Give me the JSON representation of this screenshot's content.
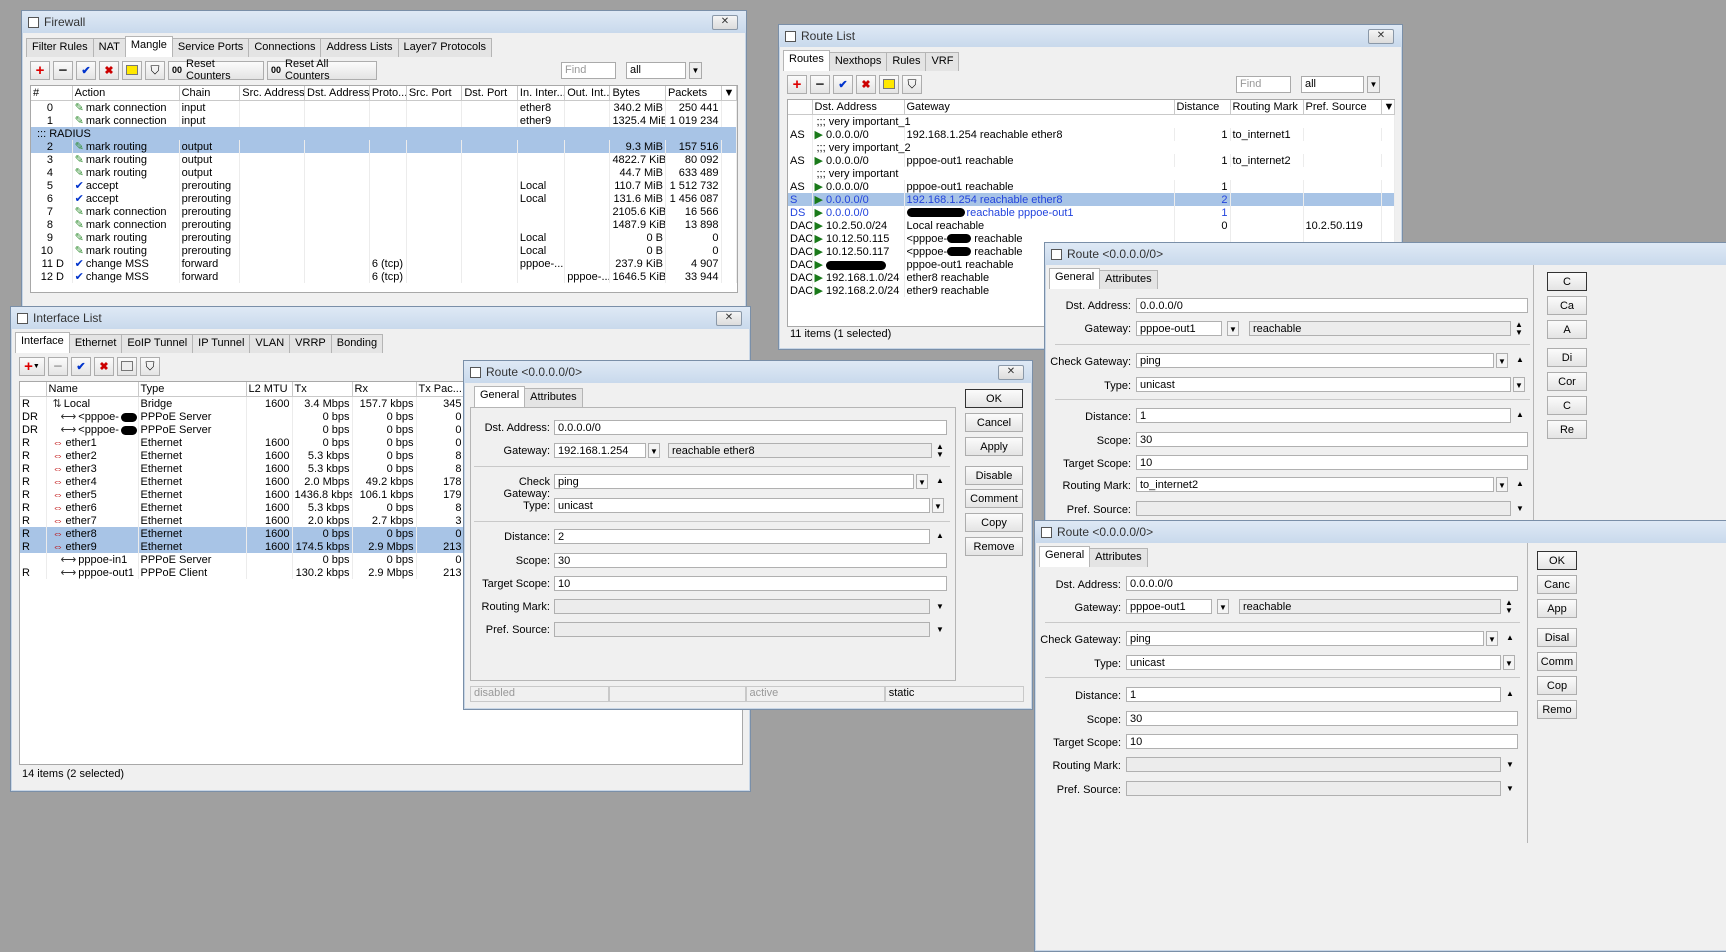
{
  "firewall": {
    "title": "Firewall",
    "tabs": [
      "Filter Rules",
      "NAT",
      "Mangle",
      "Service Ports",
      "Connections",
      "Address Lists",
      "Layer7 Protocols"
    ],
    "active_tab": "Mangle",
    "reset_counters": "Reset Counters",
    "reset_all_counters": "Reset All Counters",
    "find_placeholder": "Find",
    "filter_value": "all",
    "columns": [
      "#",
      "Action",
      "Chain",
      "Src. Address",
      "Dst. Address",
      "Proto...",
      "Src. Port",
      "Dst. Port",
      "In. Inter...",
      "Out. Int...",
      "Bytes",
      "Packets"
    ],
    "group_label": "::: RADIUS",
    "rows": [
      {
        "n": "0",
        "flag": "",
        "icon": "pen",
        "action": "mark connection",
        "chain": "input",
        "proto": "",
        "in": "ether8",
        "out": "",
        "bytes": "340.2 MiB",
        "packets": "250 441"
      },
      {
        "n": "1",
        "flag": "",
        "icon": "pen",
        "action": "mark connection",
        "chain": "input",
        "proto": "",
        "in": "ether9",
        "out": "",
        "bytes": "1325.4 MiB",
        "packets": "1 019 234"
      },
      {
        "n": "2",
        "flag": "",
        "icon": "pen",
        "action": "mark routing",
        "chain": "output",
        "proto": "",
        "in": "",
        "out": "",
        "bytes": "9.3 MiB",
        "packets": "157 516"
      },
      {
        "n": "3",
        "flag": "",
        "icon": "pen",
        "action": "mark routing",
        "chain": "output",
        "proto": "",
        "in": "",
        "out": "",
        "bytes": "4822.7 KiB",
        "packets": "80 092"
      },
      {
        "n": "4",
        "flag": "",
        "icon": "pen",
        "action": "mark routing",
        "chain": "output",
        "proto": "",
        "in": "",
        "out": "",
        "bytes": "44.7 MiB",
        "packets": "633 489"
      },
      {
        "n": "5",
        "flag": "",
        "icon": "check",
        "action": "accept",
        "chain": "prerouting",
        "proto": "",
        "in": "Local",
        "out": "",
        "bytes": "110.7 MiB",
        "packets": "1 512 732"
      },
      {
        "n": "6",
        "flag": "",
        "icon": "check",
        "action": "accept",
        "chain": "prerouting",
        "proto": "",
        "in": "Local",
        "out": "",
        "bytes": "131.6 MiB",
        "packets": "1 456 087"
      },
      {
        "n": "7",
        "flag": "",
        "icon": "pen",
        "action": "mark connection",
        "chain": "prerouting",
        "proto": "",
        "in": "",
        "out": "",
        "bytes": "2105.6 KiB",
        "packets": "16 566"
      },
      {
        "n": "8",
        "flag": "",
        "icon": "pen",
        "action": "mark connection",
        "chain": "prerouting",
        "proto": "",
        "in": "",
        "out": "",
        "bytes": "1487.9 KiB",
        "packets": "13 898"
      },
      {
        "n": "9",
        "flag": "",
        "icon": "pen",
        "action": "mark routing",
        "chain": "prerouting",
        "proto": "",
        "in": "Local",
        "out": "",
        "bytes": "0 B",
        "packets": "0"
      },
      {
        "n": "10",
        "flag": "",
        "icon": "pen",
        "action": "mark routing",
        "chain": "prerouting",
        "proto": "",
        "in": "Local",
        "out": "",
        "bytes": "0 B",
        "packets": "0"
      },
      {
        "n": "11",
        "flag": "D",
        "icon": "check",
        "action": "change MSS",
        "chain": "forward",
        "proto": "6 (tcp)",
        "in": "pppoe-...",
        "out": "",
        "bytes": "237.9 KiB",
        "packets": "4 907"
      },
      {
        "n": "12",
        "flag": "D",
        "icon": "check",
        "action": "change MSS",
        "chain": "forward",
        "proto": "6 (tcp)",
        "in": "",
        "out": "pppoe-...",
        "bytes": "1646.5 KiB",
        "packets": "33 944"
      }
    ]
  },
  "interface_list": {
    "title": "Interface List",
    "tabs": [
      "Interface",
      "Ethernet",
      "EoIP Tunnel",
      "IP Tunnel",
      "VLAN",
      "VRRP",
      "Bonding"
    ],
    "active_tab": "Interface",
    "columns": [
      "",
      "Name",
      "Type",
      "L2 MTU",
      "Tx",
      "Rx",
      "Tx Pac..."
    ],
    "rows": [
      {
        "flag": "R",
        "name": "Local",
        "type": "Bridge",
        "mtu": "1600",
        "tx": "3.4 Mbps",
        "rx": "157.7 kbps",
        "txp": "345"
      },
      {
        "flag": "DR",
        "name": "<pppoe-",
        "type": "PPPoE Server",
        "mtu": "",
        "tx": "0 bps",
        "rx": "0 bps",
        "txp": "0"
      },
      {
        "flag": "DR",
        "name": "<pppoe-",
        "type": "PPPoE Server",
        "mtu": "",
        "tx": "0 bps",
        "rx": "0 bps",
        "txp": "0"
      },
      {
        "flag": "R",
        "name": "ether1",
        "type": "Ethernet",
        "mtu": "1600",
        "tx": "0 bps",
        "rx": "0 bps",
        "txp": "0"
      },
      {
        "flag": "R",
        "name": "ether2",
        "type": "Ethernet",
        "mtu": "1600",
        "tx": "5.3 kbps",
        "rx": "0 bps",
        "txp": "8"
      },
      {
        "flag": "R",
        "name": "ether3",
        "type": "Ethernet",
        "mtu": "1600",
        "tx": "5.3 kbps",
        "rx": "0 bps",
        "txp": "8"
      },
      {
        "flag": "R",
        "name": "ether4",
        "type": "Ethernet",
        "mtu": "1600",
        "tx": "2.0 Mbps",
        "rx": "49.2 kbps",
        "txp": "178"
      },
      {
        "flag": "R",
        "name": "ether5",
        "type": "Ethernet",
        "mtu": "1600",
        "tx": "1436.8 kbps",
        "rx": "106.1 kbps",
        "txp": "179"
      },
      {
        "flag": "R",
        "name": "ether6",
        "type": "Ethernet",
        "mtu": "1600",
        "tx": "5.3 kbps",
        "rx": "0 bps",
        "txp": "8"
      },
      {
        "flag": "R",
        "name": "ether7",
        "type": "Ethernet",
        "mtu": "1600",
        "tx": "2.0 kbps",
        "rx": "2.7 kbps",
        "txp": "3"
      },
      {
        "flag": "R",
        "name": "ether8",
        "type": "Ethernet",
        "mtu": "1600",
        "tx": "0 bps",
        "rx": "0 bps",
        "txp": "0"
      },
      {
        "flag": "R",
        "name": "ether9",
        "type": "Ethernet",
        "mtu": "1600",
        "tx": "174.5 kbps",
        "rx": "2.9 Mbps",
        "txp": "213"
      },
      {
        "flag": "",
        "name": "pppoe-in1",
        "type": "PPPoE Server",
        "mtu": "",
        "tx": "0 bps",
        "rx": "0 bps",
        "txp": "0"
      },
      {
        "flag": "R",
        "name": "pppoe-out1",
        "type": "PPPoE Client",
        "mtu": "",
        "tx": "130.2 kbps",
        "rx": "2.9 Mbps",
        "txp": "213"
      }
    ],
    "status": "14 items (2 selected)"
  },
  "route_list": {
    "title": "Route List",
    "tabs": [
      "Routes",
      "Nexthops",
      "Rules",
      "VRF"
    ],
    "active_tab": "Routes",
    "find_placeholder": "Find",
    "filter_value": "all",
    "columns": [
      "",
      "Dst. Address",
      "Gateway",
      "Distance",
      "Routing Mark",
      "Pref. Source"
    ],
    "rows": [
      {
        "kind": "group",
        "text": ";;; very important_1"
      },
      {
        "kind": "row",
        "flag": "AS",
        "dst": "0.0.0.0/0",
        "gw": "192.168.1.254 reachable ether8",
        "dist": "1",
        "mark": "to_internet1",
        "src": ""
      },
      {
        "kind": "group",
        "text": ";;; very important_2"
      },
      {
        "kind": "row",
        "flag": "AS",
        "dst": "0.0.0.0/0",
        "gw": "pppoe-out1 reachable",
        "dist": "1",
        "mark": "to_internet2",
        "src": ""
      },
      {
        "kind": "group",
        "text": ";;; very important"
      },
      {
        "kind": "row",
        "flag": "AS",
        "dst": "0.0.0.0/0",
        "gw": "pppoe-out1 reachable",
        "dist": "1",
        "mark": "",
        "src": ""
      },
      {
        "kind": "row",
        "flag": "S",
        "dst": "0.0.0.0/0",
        "gw": "192.168.1.254 reachable ether8",
        "dist": "2",
        "mark": "",
        "src": ""
      },
      {
        "kind": "row",
        "flag": "DS",
        "dst": "0.0.0.0/0",
        "gw": "reachable pppoe-out1",
        "dist": "1",
        "mark": "",
        "src": ""
      },
      {
        "kind": "row",
        "flag": "DAC",
        "dst": "10.2.50.0/24",
        "gw": "Local reachable",
        "dist": "0",
        "mark": "",
        "src": "10.2.50.119"
      },
      {
        "kind": "row",
        "flag": "DAC",
        "dst": "10.12.50.115",
        "gw": "<pppoe- reachable",
        "dist": "",
        "mark": "",
        "src": ""
      },
      {
        "kind": "row",
        "flag": "DAC",
        "dst": "10.12.50.117",
        "gw": "<pppoe- reachable",
        "dist": "",
        "mark": "",
        "src": ""
      },
      {
        "kind": "row",
        "flag": "DAC",
        "dst": "",
        "gw": "pppoe-out1 reachable",
        "dist": "",
        "mark": "",
        "src": ""
      },
      {
        "kind": "row",
        "flag": "DAC",
        "dst": "192.168.1.0/24",
        "gw": "ether8 reachable",
        "dist": "",
        "mark": "",
        "src": ""
      },
      {
        "kind": "row",
        "flag": "DAC",
        "dst": "192.168.2.0/24",
        "gw": "ether9 reachable",
        "dist": "",
        "mark": "",
        "src": ""
      }
    ],
    "status": "11 items (1 selected)"
  },
  "route_dialog_main": {
    "title": "Route <0.0.0.0/0>",
    "tabs": [
      "General",
      "Attributes"
    ],
    "dst_label": "Dst. Address:",
    "dst": "0.0.0.0/0",
    "gw_label": "Gateway:",
    "gw": "192.168.1.254",
    "gw_state": "reachable ether8",
    "check_label": "Check Gateway:",
    "check": "ping",
    "type_label": "Type:",
    "type": "unicast",
    "distance_label": "Distance:",
    "distance": "2",
    "scope_label": "Scope:",
    "scope": "30",
    "target_label": "Target Scope:",
    "target": "10",
    "mark_label": "Routing Mark:",
    "mark": "",
    "pref_label": "Pref. Source:",
    "pref": "",
    "buttons": [
      "OK",
      "Cancel",
      "Apply",
      "Disable",
      "Comment",
      "Copy",
      "Remove"
    ],
    "status": [
      "disabled",
      "",
      "active",
      "static"
    ]
  },
  "route_dialog_2": {
    "title": "Route <0.0.0.0/0>",
    "tabs": [
      "General",
      "Attributes"
    ],
    "dst": "0.0.0.0/0",
    "gw": "pppoe-out1",
    "gw_state": "reachable",
    "check": "ping",
    "type": "unicast",
    "distance": "1",
    "scope": "30",
    "target": "10",
    "mark": "to_internet2",
    "pref": "",
    "buttons": [
      "C",
      "Ca",
      "A",
      "Di",
      "Cor",
      "C",
      "Re"
    ]
  },
  "route_dialog_3": {
    "title": "Route <0.0.0.0/0>",
    "tabs": [
      "General",
      "Attributes"
    ],
    "dst": "0.0.0.0/0",
    "gw": "pppoe-out1",
    "gw_state": "reachable",
    "check": "ping",
    "type": "unicast",
    "distance": "1",
    "scope": "30",
    "target": "10",
    "mark": "",
    "pref": "",
    "buttons": [
      "OK",
      "Canc",
      "App",
      "Disal",
      "Comm",
      "Cop",
      "Remo"
    ]
  },
  "colors": {
    "selection": "#a8c4e6",
    "desktop": "#a0a0a0",
    "titlebar": "#c9d9ec",
    "disabled_route_text": "#2244dd"
  }
}
